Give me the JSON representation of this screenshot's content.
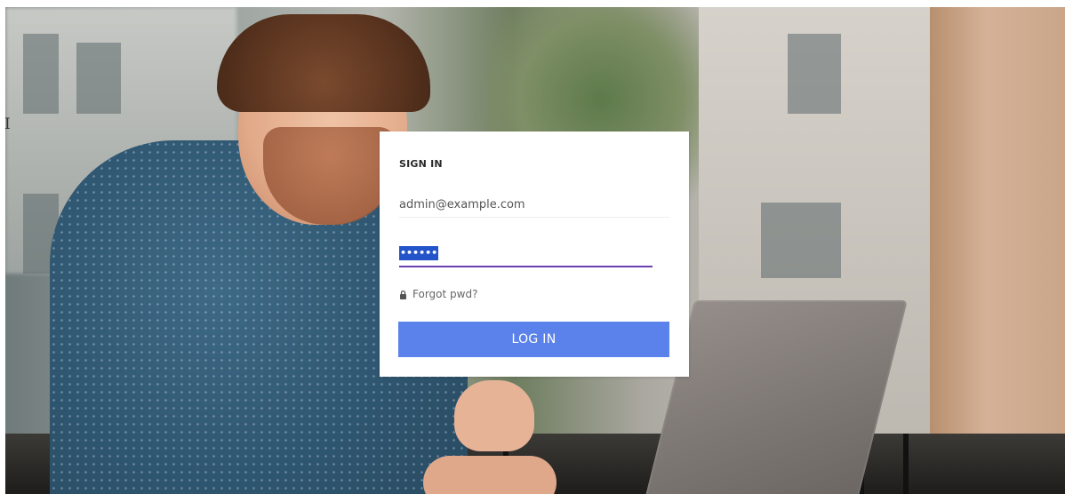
{
  "login": {
    "title": "SIGN IN",
    "email_value": "admin@example.com",
    "password_masked": "••••••",
    "forgot_label": "Forgot pwd?",
    "button_label": "LOG IN"
  },
  "icons": {
    "lock": "lock-icon",
    "text_cursor": "I"
  },
  "colors": {
    "button": "#5b82ea",
    "password_underline": "#6d3fb0",
    "selection": "#2354c9"
  }
}
